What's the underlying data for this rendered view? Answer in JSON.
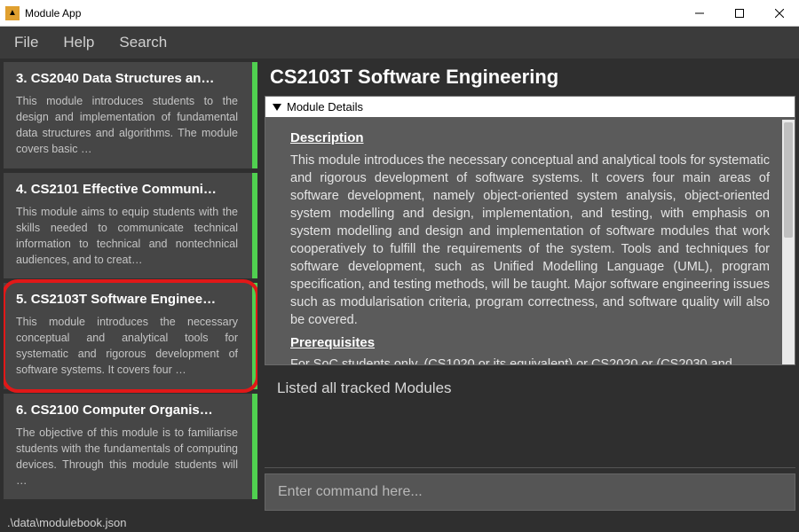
{
  "window": {
    "title": "Module App"
  },
  "menubar": {
    "items": [
      "File",
      "Help",
      "Search"
    ]
  },
  "sidebar": {
    "items": [
      {
        "index": "3.",
        "title": "CS2040 Data Structures an…",
        "desc": "This module introduces students to the design and implementation of fundamental data structures and algorithms. The module covers basic …"
      },
      {
        "index": "4.",
        "title": "CS2101 Effective Communi…",
        "desc": "This module aims to equip students with the skills needed to communicate technical information to technical and nontechnical audiences, and to creat…"
      },
      {
        "index": "5.",
        "title": "CS2103T Software Enginee…",
        "desc": "This module introduces the necessary conceptual and analytical tools for systematic and rigorous development of software systems. It covers four …"
      },
      {
        "index": "6.",
        "title": "CS2100 Computer Organis…",
        "desc": "The objective of this module is to familiarise students with the fundamentals of computing devices. Through this module students will …"
      }
    ],
    "highlighted_index": 2
  },
  "detail": {
    "title": "CS2103T Software Engineering",
    "panel_header": "Module Details",
    "description_heading": "Description",
    "description_body": "This module introduces the necessary conceptual and analytical tools for systematic and rigorous development of software systems. It covers four main areas of software development, namely object-oriented system analysis, object-oriented system modelling and design, implementation, and testing, with emphasis on system modelling and design and implementation of software modules that work cooperatively to fulfill the requirements of the system. Tools and techniques for software development, such as Unified Modelling Language (UML), program specification, and testing methods, will be taught. Major software engineering issues such as modularisation criteria, program correctness, and software quality will also be covered.",
    "prereq_heading": "Prerequisites",
    "prereq_body": "For SoC students only. (CS1020 or its equivalent) or CS2020 or (CS2030 and"
  },
  "status": "Listed all tracked Modules",
  "command": {
    "placeholder": "Enter command here..."
  },
  "footer": {
    "path": ".\\data\\modulebook.json"
  }
}
